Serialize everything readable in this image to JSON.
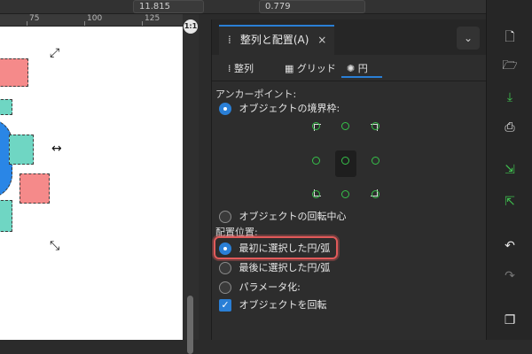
{
  "topbar": {
    "x_value": "11.815",
    "y_value": "0.779"
  },
  "ruler": {
    "ticks": [
      "75",
      "100",
      "125"
    ]
  },
  "canvas": {
    "zoom_badge": "1:1"
  },
  "panel": {
    "title": "整列と配置(A)",
    "close_glyph": "×",
    "collapse_glyph": "⌄",
    "tabs": [
      {
        "label": "整列"
      },
      {
        "label": "グリッド"
      },
      {
        "label": "円"
      }
    ],
    "anchor_label": "アンカーポイント:",
    "anchor_bbox_label": "オブジェクトの境界枠:",
    "anchor_rotation_label": "オブジェクトの回転中心",
    "placement_label": "配置位置:",
    "placement_options": [
      {
        "label": "最初に選択した円/弧",
        "selected": true
      },
      {
        "label": "最後に選択した円/弧",
        "selected": false
      },
      {
        "label": "パラメータ化:",
        "selected": false
      }
    ],
    "rotate_objects_label": "オブジェクトを回転",
    "rotate_objects_checked": true
  },
  "colors": {
    "accent": "#2a7fd6",
    "highlight": "#e05a5a",
    "anchor_green": "#36c24a",
    "pink_square": "#f58a8a",
    "teal_square": "#6fd6c3",
    "blue_circle": "#2a86e6"
  },
  "right_toolbar": {
    "icons": [
      "new-document-icon",
      "open-folder-icon",
      "save-icon",
      "print-icon",
      "import-icon",
      "export-icon",
      "undo-icon",
      "redo-icon",
      "duplicate-icon"
    ]
  }
}
